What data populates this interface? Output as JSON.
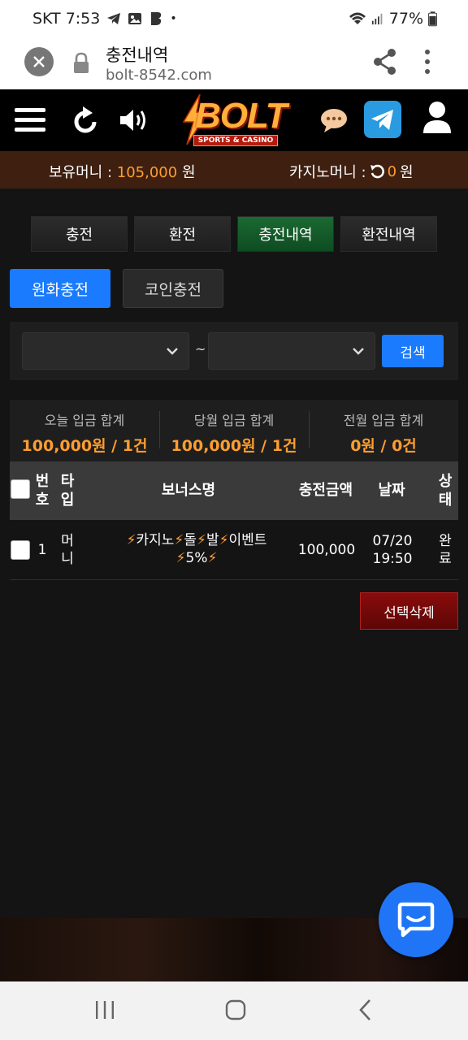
{
  "status_bar": {
    "carrier_time": "SKT 7:53",
    "battery": "77%"
  },
  "browser": {
    "title": "충전내역",
    "url": "bolt-8542.com"
  },
  "logo": {
    "text": "BOLT",
    "subtitle": "SPORTS & CASINO"
  },
  "money": {
    "holding_label": "보유머니 :",
    "holding_value": "105,000",
    "holding_unit": "원",
    "casino_label": "카지노머니 :",
    "casino_value": "0",
    "casino_unit": "원"
  },
  "tabs": [
    {
      "label": "충전"
    },
    {
      "label": "환전"
    },
    {
      "label": "충전내역"
    },
    {
      "label": "환전내역"
    }
  ],
  "subtabs": [
    {
      "label": "원화충전"
    },
    {
      "label": "코인충전"
    }
  ],
  "search": {
    "tilde": "~",
    "button": "검색"
  },
  "summary": [
    {
      "label": "오늘 입금 합계",
      "value": "100,000원 / 1건"
    },
    {
      "label": "당월 입금 합계",
      "value": "100,000원 / 1건"
    },
    {
      "label": "전월 입금 합계",
      "value": "0원 / 0건"
    }
  ],
  "table": {
    "headers": {
      "num_1": "번",
      "num_2": "호",
      "type_1": "타",
      "type_2": "입",
      "bonus": "보너스명",
      "amount": "충전금액",
      "date": "날짜",
      "status_1": "상",
      "status_2": "태"
    },
    "rows": [
      {
        "num": "1",
        "type_1": "머",
        "type_2": "니",
        "bonus_1": "카지노",
        "bonus_2": "돌",
        "bonus_3": "발",
        "bonus_4": "이벤트",
        "bonus_5": "5%",
        "amount": "100,000",
        "date_1": "07/20",
        "date_2": "19:50",
        "status_1": "완",
        "status_2": "료"
      }
    ]
  },
  "delete_button": "선택삭제",
  "colors": {
    "accent_blue": "#1a7bff",
    "orange": "#ff9d2f",
    "active_tab": "#1a6a32",
    "danger": "#8a0c0c"
  }
}
